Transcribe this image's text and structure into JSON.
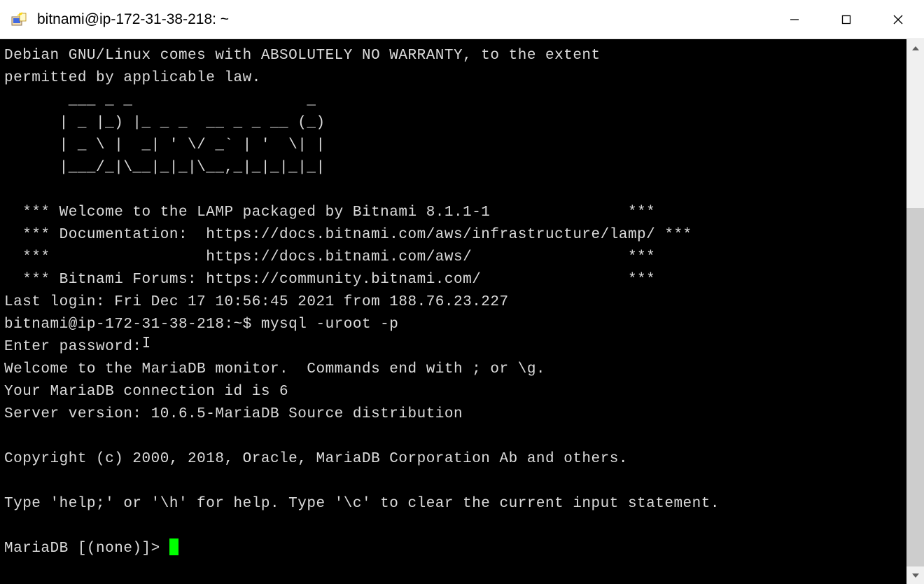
{
  "window": {
    "title": "bitnami@ip-172-31-38-218: ~"
  },
  "terminal": {
    "lines": [
      "Debian GNU/Linux comes with ABSOLUTELY NO WARRANTY, to the extent",
      "permitted by applicable law.",
      "       ___ _ _                   _",
      "      | _ |_) |_ _ _  __ _ _ __ (_)",
      "      | _ \\ |  _| ' \\/ _` | '  \\| |",
      "      |___/_|\\__|_|_|\\__,_|_|_|_|_|",
      "",
      "  *** Welcome to the LAMP packaged by Bitnami 8.1.1-1               ***",
      "  *** Documentation:  https://docs.bitnami.com/aws/infrastructure/lamp/ ***",
      "  ***                 https://docs.bitnami.com/aws/                 ***",
      "  *** Bitnami Forums: https://community.bitnami.com/                ***",
      "Last login: Fri Dec 17 10:56:45 2021 from 188.76.23.227",
      "bitnami@ip-172-31-38-218:~$ mysql -uroot -p",
      "Enter password:",
      "Welcome to the MariaDB monitor.  Commands end with ; or \\g.",
      "Your MariaDB connection id is 6",
      "Server version: 10.6.5-MariaDB Source distribution",
      "",
      "Copyright (c) 2000, 2018, Oracle, MariaDB Corporation Ab and others.",
      "",
      "Type 'help;' or '\\h' for help. Type '\\c' to clear the current input statement.",
      ""
    ],
    "prompt": "MariaDB [(none)]> "
  }
}
